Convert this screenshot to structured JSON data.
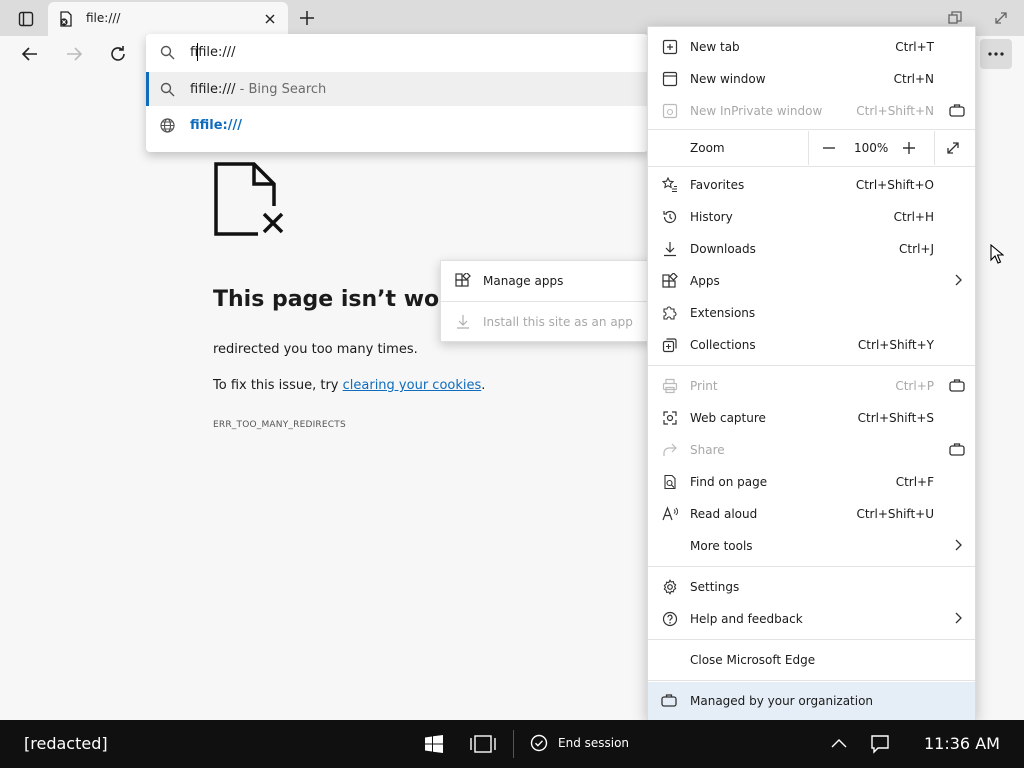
{
  "tab": {
    "title": "file:///"
  },
  "omnibox": {
    "input_value": "fifile:///",
    "suggestions": [
      {
        "text": "fifile:///",
        "suffix": " - Bing Search"
      },
      {
        "text": "fifile:///"
      }
    ]
  },
  "error_page": {
    "heading": "This page isn’t work",
    "description": "redirected you too many times.",
    "fix_prefix": "To fix this issue, try ",
    "fix_link": "clearing your cookies",
    "fix_suffix": ".",
    "error_code": "ERR_TOO_MANY_REDIRECTS"
  },
  "apps_submenu": {
    "items": [
      {
        "label": "Manage apps",
        "enabled": true
      },
      {
        "label": "Install this site as an app",
        "enabled": false
      }
    ]
  },
  "menu": {
    "items": [
      {
        "label": "New tab",
        "shortcut": "Ctrl+T"
      },
      {
        "label": "New window",
        "shortcut": "Ctrl+N"
      },
      {
        "label": "New InPrivate window",
        "shortcut": "Ctrl+Shift+N",
        "disabled": true
      },
      {
        "label": "Favorites",
        "shortcut": "Ctrl+Shift+O"
      },
      {
        "label": "History",
        "shortcut": "Ctrl+H"
      },
      {
        "label": "Downloads",
        "shortcut": "Ctrl+J"
      },
      {
        "label": "Apps",
        "shortcut": ""
      },
      {
        "label": "Extensions",
        "shortcut": ""
      },
      {
        "label": "Collections",
        "shortcut": "Ctrl+Shift+Y"
      },
      {
        "label": "Print",
        "shortcut": "Ctrl+P",
        "disabled": true
      },
      {
        "label": "Web capture",
        "shortcut": "Ctrl+Shift+S"
      },
      {
        "label": "Share",
        "shortcut": "",
        "disabled": true
      },
      {
        "label": "Find on page",
        "shortcut": "Ctrl+F"
      },
      {
        "label": "Read aloud",
        "shortcut": "Ctrl+Shift+U"
      },
      {
        "label": "More tools",
        "shortcut": ""
      },
      {
        "label": "Settings",
        "shortcut": ""
      },
      {
        "label": "Help and feedback",
        "shortcut": ""
      },
      {
        "label": "Close Microsoft Edge",
        "shortcut": ""
      }
    ],
    "zoom": {
      "label": "Zoom",
      "value": "100%"
    },
    "managed_label": "Managed by your organization"
  },
  "taskbar": {
    "label": "[redacted]",
    "end_session": "End session",
    "clock": "11:36 AM"
  },
  "colors": {
    "accent": "#0f6cbd",
    "taskbar": "#101010",
    "managed_bg": "#e5eef6"
  }
}
